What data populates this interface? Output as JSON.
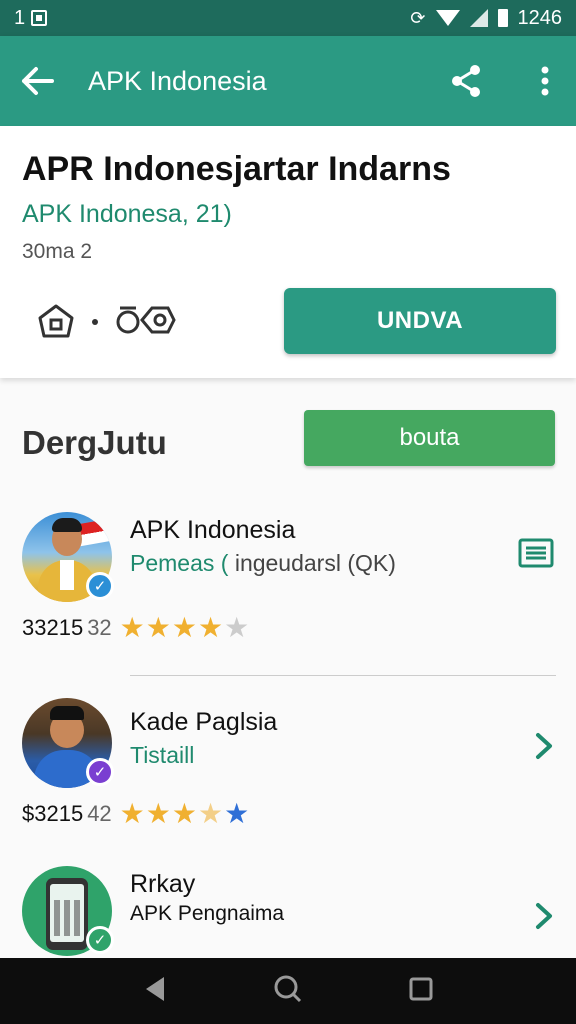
{
  "status_bar": {
    "left_text": "1",
    "time": "1246"
  },
  "app_bar": {
    "title": "APK Indonesia",
    "back_icon": "arrow-back-icon",
    "share_icon": "share-icon",
    "more_icon": "more-vert-icon"
  },
  "header": {
    "title": "APR Indonesjartar Indarns",
    "subtitle": "APK Indonesa, 21)",
    "meta": "30ma 2",
    "icons": [
      "home-icon",
      "dot-icon",
      "settings-gear-icon"
    ],
    "primary_button": "UNDVA"
  },
  "section": {
    "title": "DergJutu",
    "button": "bouta"
  },
  "items": [
    {
      "name": "APK Indonesia",
      "sub_highlight": "Pemeas (",
      "sub_rest": " ingeudarsl  (QK)",
      "count": "33215",
      "count_sub": "32",
      "stars": 4,
      "badge_color": "#2b8fd6",
      "action_icon": "list-icon"
    },
    {
      "name": "Kade Paglsia",
      "sub_highlight": "Tistaill",
      "sub_rest": "",
      "count": "$3215",
      "count_sub": "42",
      "stars": 3,
      "badge_color": "#7a3fd1",
      "action_icon": "chevron-right-icon"
    },
    {
      "name": "Rrkay",
      "sub_highlight": "",
      "sub_rest": "APK Pengnaima",
      "badge_color": "#2fa36a",
      "action_icon": "chevron-right-icon"
    }
  ],
  "nav": {
    "back": "nav-back-icon",
    "home": "nav-home-icon",
    "recents": "nav-recents-icon"
  },
  "colors": {
    "primary": "#2b9a83",
    "status": "#1e6b5c",
    "accent_green": "#45a860",
    "star": "#f0b030"
  }
}
